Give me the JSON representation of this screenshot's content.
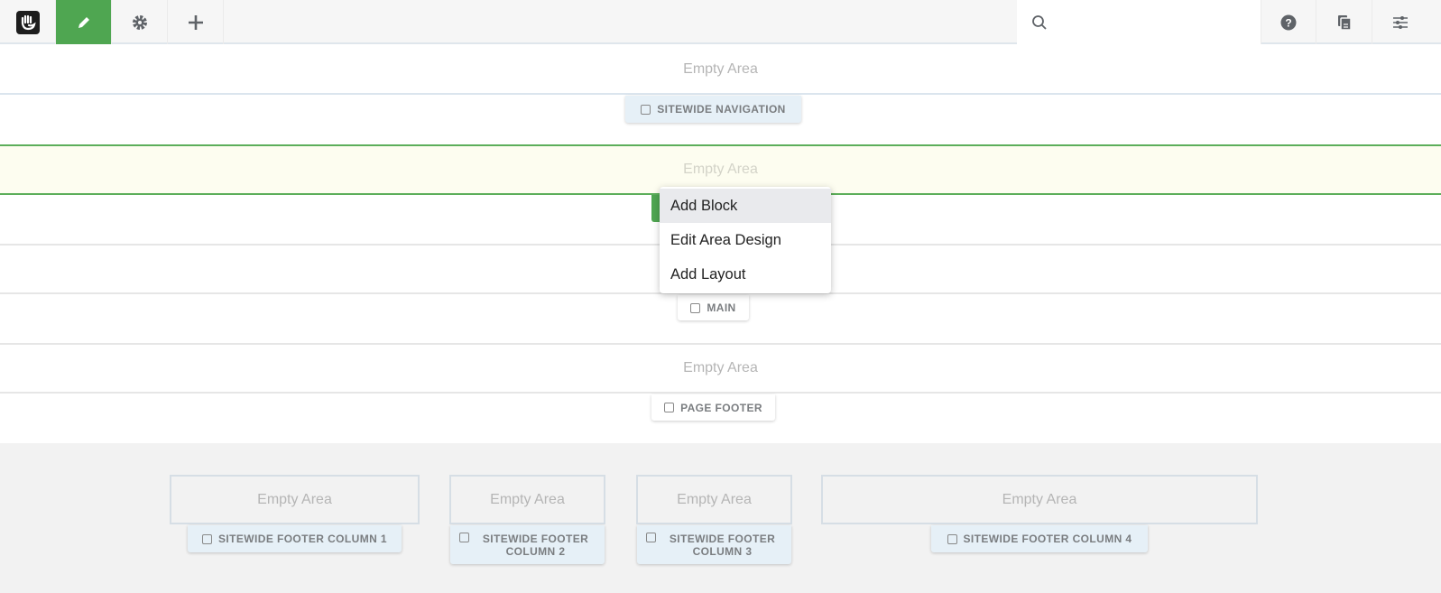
{
  "toolbar": {
    "icons": [
      "concrete-logo-icon",
      "pencil-icon",
      "gear-icon",
      "plus-icon",
      "search-icon",
      "help-icon",
      "pages-icon",
      "sliders-icon"
    ],
    "edit_active_color": "#4fa651",
    "search_placeholder": ""
  },
  "areas": [
    {
      "empty_text": "Empty Area",
      "tab_label": "SITEWIDE NAVIGATION",
      "global": true
    },
    {
      "empty_text": "Empty Area",
      "highlighted": true,
      "highlight_color": "#4fa651"
    },
    {
      "tab_label": "MAIN"
    },
    {
      "empty_text": "Empty Area",
      "tab_label": "PAGE FOOTER"
    }
  ],
  "footer_columns": [
    {
      "empty_text": "Empty Area",
      "tab_label": "SITEWIDE FOOTER COLUMN 1"
    },
    {
      "empty_text": "Empty Area",
      "tab_label": "SITEWIDE FOOTER COLUMN 2"
    },
    {
      "empty_text": "Empty Area",
      "tab_label": "SITEWIDE FOOTER COLUMN 3"
    },
    {
      "empty_text": "Empty Area",
      "tab_label": "SITEWIDE FOOTER COLUMN 4"
    }
  ],
  "context_menu": {
    "items": [
      "Add Block",
      "Edit Area Design",
      "Add Layout"
    ],
    "active_index": 0
  }
}
